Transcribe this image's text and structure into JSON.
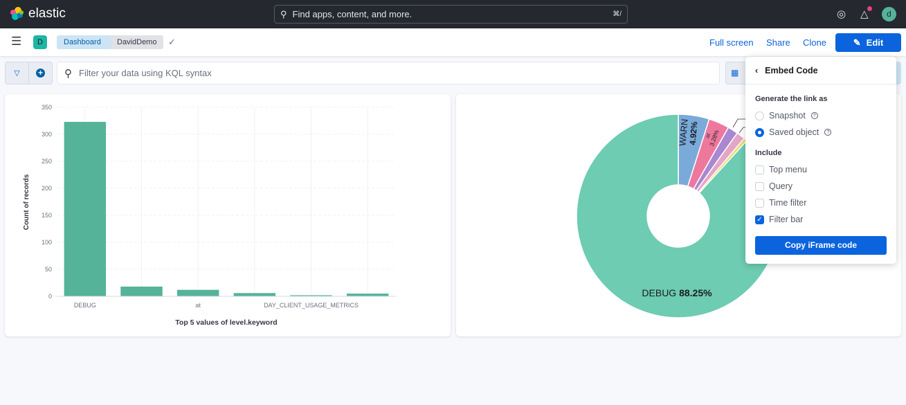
{
  "header": {
    "logo_text": "elastic",
    "search_placeholder": "Find apps, content, and more.",
    "search_shortcut": "⌘/",
    "user_initial": "d",
    "icons": [
      "help-icon",
      "newsfeed-icon"
    ]
  },
  "subheader": {
    "space_initial": "D",
    "breadcrumbs": [
      "Dashboard",
      "DavidDemo"
    ],
    "actions": {
      "full_screen": "Full screen",
      "share": "Share",
      "clone": "Clone",
      "edit": "Edit"
    }
  },
  "filter_bar": {
    "query_placeholder": "Filter your data using KQL syntax"
  },
  "share_popover": {
    "title": "Embed Code",
    "generate_label": "Generate the link as",
    "generate_options": [
      {
        "label": "Snapshot",
        "selected": false
      },
      {
        "label": "Saved object",
        "selected": true
      }
    ],
    "include_label": "Include",
    "include_options": [
      {
        "label": "Top menu",
        "checked": false
      },
      {
        "label": "Query",
        "checked": false
      },
      {
        "label": "Time filter",
        "checked": false
      },
      {
        "label": "Filter bar",
        "checked": true
      }
    ],
    "copy_button": "Copy iFrame code"
  },
  "chart_data": [
    {
      "type": "bar",
      "categories": [
        "DEBUG",
        "",
        "at",
        "",
        "DAY_CLIENT_USAGE_METRICS",
        ""
      ],
      "values": [
        323,
        18,
        12,
        6,
        2,
        5
      ],
      "xlabel": "Top 5 values of level.keyword",
      "ylabel": "Count of records",
      "ylim": [
        0,
        350
      ],
      "yticks": [
        0,
        50,
        100,
        150,
        200,
        250,
        300,
        350
      ],
      "grid": true,
      "color": "#54b399"
    },
    {
      "type": "pie",
      "donut": true,
      "slices": [
        {
          "label": "DEBUG",
          "value": 88.25,
          "display": "88.25%",
          "color": "#6dccb1"
        },
        {
          "label": "WARN",
          "value": 4.92,
          "display": "4.92%",
          "color": "#79aad9"
        },
        {
          "label": "at",
          "value": 3.28,
          "display": "3.28%",
          "color": "#ee789d"
        },
        {
          "label": "",
          "value": 1.64,
          "color": "#a987d1"
        },
        {
          "label": "",
          "value": 1.37,
          "color": "#e4a6c7"
        },
        {
          "label": "",
          "value": 0.54,
          "color": "#f1d86f"
        }
      ]
    }
  ]
}
